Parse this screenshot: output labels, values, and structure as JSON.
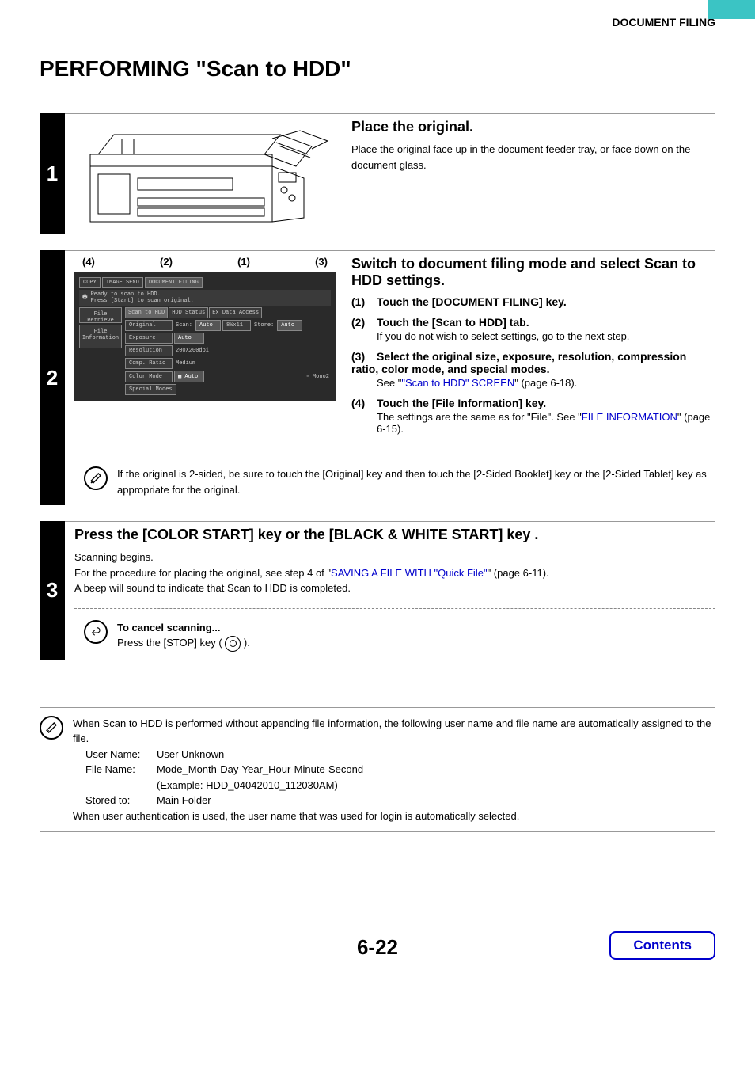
{
  "header": {
    "section": "DOCUMENT FILING"
  },
  "title": "PERFORMING \"Scan to HDD\"",
  "step1": {
    "num": "1",
    "heading": "Place the original.",
    "body": "Place the original face up in the document feeder tray, or face down on the document glass."
  },
  "step2": {
    "num": "2",
    "markers": {
      "m1": "(4)",
      "m2": "(2)",
      "m3": "(1)",
      "m4": "(3)"
    },
    "screen": {
      "tab_copy": "COPY",
      "tab_imgsend": "IMAGE SEND",
      "tab_docfiling": "DOCUMENT FILING",
      "header_a": "Ready to scan to HDD.",
      "header_b": "Press [Start] to scan original.",
      "sub_retrieve": "File Retrieve",
      "sub_scanhdd": "Scan to HDD",
      "sub_hddstat": "HDD Status",
      "sub_extdata": "Ex Data Access",
      "side_fileinfo": "File Information",
      "row_original": "Original",
      "row_scan": "Scan:",
      "row_scan_auto": "Auto",
      "row_scan_size": "8½x11",
      "row_store": "Store:",
      "row_store_auto": "Auto",
      "row_exposure": "Exposure",
      "row_exposure_v": "Auto",
      "row_resolution": "Resolution",
      "row_resolution_v": "200X200dpi",
      "row_comp": "Comp. Ratio",
      "row_comp_v": "Medium",
      "row_color": "Color Mode",
      "row_color_v": "Auto",
      "row_color_mono": "Mono2",
      "row_special": "Special Modes"
    },
    "heading": "Switch to document filing mode and select Scan to HDD settings.",
    "items": [
      {
        "num": "(1)",
        "bold": "Touch the [DOCUMENT FILING] key."
      },
      {
        "num": "(2)",
        "bold": "Touch the [Scan to HDD] tab.",
        "detail": "If you do not wish to select settings, go to the next step."
      },
      {
        "num": "(3)",
        "bold": "Select the original size, exposure, resolution, compression ratio, color mode, and special modes.",
        "detail_pre": "See \"",
        "link": "\"Scan to HDD\" SCREEN",
        "detail_post": "\" (page 6-18)."
      },
      {
        "num": "(4)",
        "bold": "Touch the [File Information] key.",
        "detail_pre": "The settings are the same as for \"File\". See \"",
        "link": "FILE INFORMATION",
        "detail_post": "\" (page 6-15)."
      }
    ],
    "note": "If the original is 2-sided, be sure to touch the [Original] key and then touch the [2-Sided Booklet] key or the [2-Sided Tablet] key as appropriate for the original."
  },
  "step3": {
    "num": "3",
    "heading": "Press the [COLOR START] key or the [BLACK & WHITE START] key .",
    "line1": "Scanning begins.",
    "line2_pre": "For the procedure for placing the original, see step 4 of \"",
    "line2_link": "SAVING A FILE WITH \"Quick File\"",
    "line2_post": "\" (page 6-11).",
    "line3": "A beep will sound to indicate that Scan to HDD is completed.",
    "cancel_title": "To cancel scanning...",
    "cancel_body_pre": "Press the [STOP] key ( ",
    "cancel_body_post": " )."
  },
  "info_block": {
    "line1": "When Scan to HDD is performed without appending file information, the following user name and file name are automatically assigned to the file.",
    "username_k": "User Name:",
    "username_v": "User Unknown",
    "filename_k": "File Name:",
    "filename_v": "Mode_Month-Day-Year_Hour-Minute-Second",
    "filename_ex": "(Example: HDD_04042010_112030AM)",
    "stored_k": "Stored to:",
    "stored_v": "Main Folder",
    "line2": "When user authentication is used, the user name that was used for login is automatically selected."
  },
  "footer": {
    "pagenum": "6-22",
    "contents": "Contents"
  }
}
